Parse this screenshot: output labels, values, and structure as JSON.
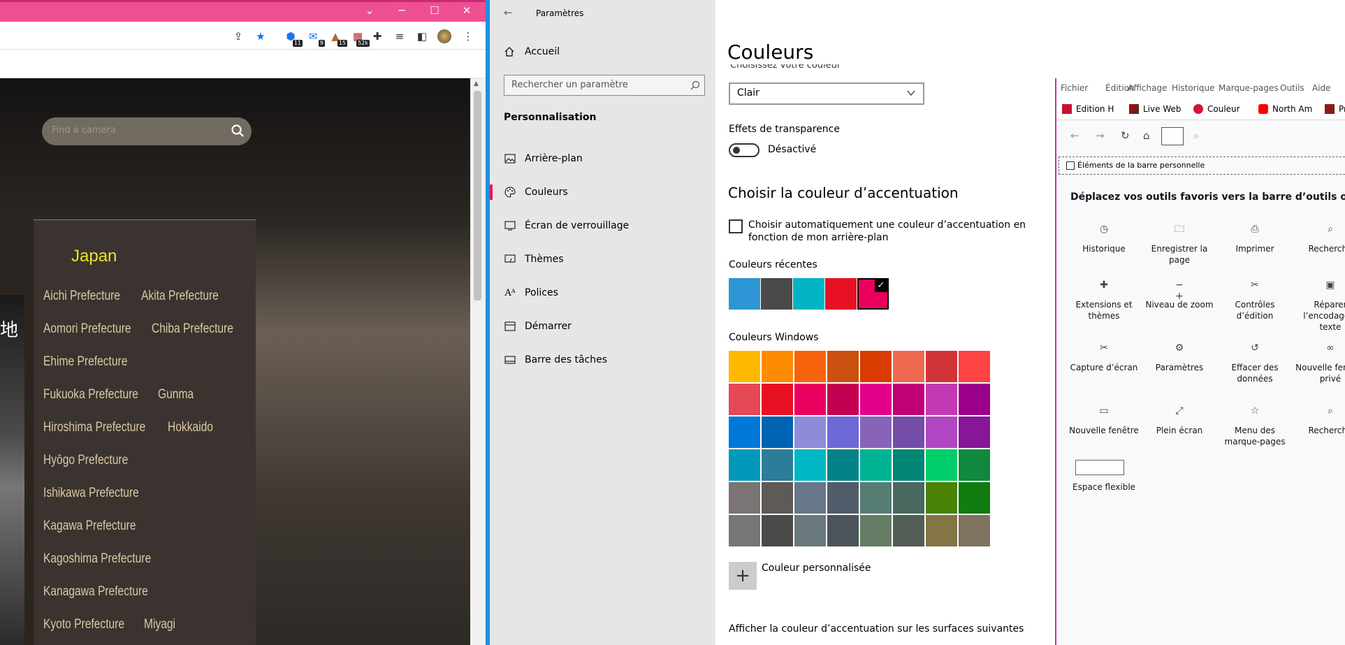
{
  "chrome": {
    "extension_badges": [
      "11",
      "9",
      "15",
      "52k"
    ],
    "search_placeholder": "Find a camera",
    "region_title": "Japan",
    "prefectures": [
      "Aichi Prefecture",
      "Akita Prefecture",
      "Aomori Prefecture",
      "Chiba Prefecture",
      "Ehime Prefecture",
      "Fukuoka Prefecture",
      "Gunma",
      "Hiroshima Prefecture",
      "Hokkaido",
      "Hyōgo Prefecture",
      "Ishikawa Prefecture",
      "Kagawa Prefecture",
      "Kagoshima Prefecture",
      "Kanagawa Prefecture",
      "Kyoto Prefecture",
      "Miyagi"
    ],
    "photo_text": "地"
  },
  "settings": {
    "window_title": "Paramètres",
    "home": "Accueil",
    "search_placeholder": "Rechercher un paramètre",
    "section": "Personnalisation",
    "nav_items": [
      "Arrière-plan",
      "Couleurs",
      "Écran de verrouillage",
      "Thèmes",
      "Polices",
      "Démarrer",
      "Barre des tâches"
    ],
    "active_item": "Couleurs",
    "page_title": "Couleurs",
    "choose_color_label": "Choisissez votre couleur",
    "choose_color_value": "Clair",
    "transparency_label": "Effets de transparence",
    "transparency_state": "Désactivé",
    "accent_heading": "Choisir la couleur d’accentuation",
    "auto_accent_label": "Choisir automatiquement une couleur d’accentuation en fonction de mon arrière-plan",
    "recent_label": "Couleurs récentes",
    "recent_colors": [
      "#2d95d4",
      "#4c4a48",
      "#00b4c4",
      "#e81123",
      "#ea005e"
    ],
    "windows_label": "Couleurs Windows",
    "windows_colors": [
      "#ffb900",
      "#ff8c00",
      "#f7630c",
      "#ca5010",
      "#da3b01",
      "#ef6950",
      "#d13438",
      "#ff4343",
      "#e74856",
      "#e81123",
      "#ea005e",
      "#c30052",
      "#e3008c",
      "#bf0077",
      "#c239b3",
      "#9a0089",
      "#0078d7",
      "#0063b1",
      "#8e8cd8",
      "#6b69d6",
      "#8764b8",
      "#744da9",
      "#b146c2",
      "#881798",
      "#0099bc",
      "#2d7d9a",
      "#00b7c3",
      "#038387",
      "#00b294",
      "#018574",
      "#00cc6a",
      "#10893e",
      "#7a7574",
      "#5d5a58",
      "#68768a",
      "#515c6b",
      "#567c73",
      "#486860",
      "#498205",
      "#107c10",
      "#767676",
      "#4c4a48",
      "#69797e",
      "#4a5459",
      "#647c64",
      "#525e54",
      "#847545",
      "#7e735f"
    ],
    "custom_color_label": "Couleur personnalisée",
    "surfaces_label": "Afficher la couleur d’accentuation sur les surfaces suivantes"
  },
  "firefox": {
    "menu": [
      "Fichier",
      "Édition",
      "Affichage",
      "Historique",
      "Marque-pages",
      "Outils",
      "Aide"
    ],
    "tabs": [
      "Edition H",
      "Live Web",
      "Couleur",
      "North Am",
      "Pr"
    ],
    "personal_bar": "Éléments de la barre personnelle",
    "instruction": "Déplacez vos outils favoris vers la barre d’outils ou le menu qui",
    "items": [
      {
        "label": "Historique",
        "icon": "clock-icon"
      },
      {
        "label": "Enregistrer la page",
        "icon": "save-folder-icon"
      },
      {
        "label": "Imprimer",
        "icon": "printer-icon"
      },
      {
        "label": "Recherche",
        "icon": "search-icon"
      },
      {
        "label": "Extensions et thèmes",
        "icon": "puzzle-icon"
      },
      {
        "label": "Niveau de zoom",
        "icon": "zoom-icon"
      },
      {
        "label": "Contrôles d’édition",
        "icon": "scissors-icon"
      },
      {
        "label": "Réparer l’encodage d texte",
        "icon": "encoding-icon"
      },
      {
        "label": "Capture d’écran",
        "icon": "screenshot-icon"
      },
      {
        "label": "Paramètres",
        "icon": "gear-icon"
      },
      {
        "label": "Effacer des données",
        "icon": "history-clear-icon"
      },
      {
        "label": "Nouvelle fenêtre privé",
        "icon": "mask-icon"
      },
      {
        "label": "Nouvelle fenêtre",
        "icon": "window-icon"
      },
      {
        "label": "Plein écran",
        "icon": "fullscreen-icon"
      },
      {
        "label": "Menu des marque-pages",
        "icon": "bookmarks-menu-icon"
      },
      {
        "label": "Recherche",
        "icon": "search-icon"
      },
      {
        "label": "Espace flexible",
        "icon": "flex-space-icon"
      }
    ]
  }
}
